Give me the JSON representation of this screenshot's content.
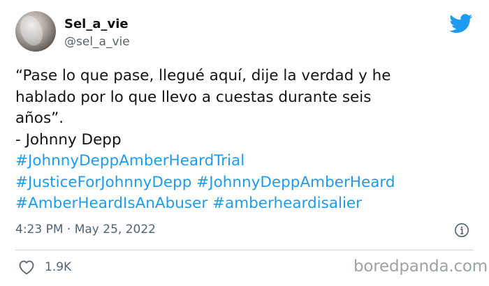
{
  "author": {
    "display_name": "Sel_a_vie",
    "handle": "@sel_a_vie"
  },
  "tweet": {
    "lines": [
      "“Pase lo que pase, llegué aquí, dije la verdad y he",
      "hablado por lo que llevo a cuestas durante seis",
      "años”.",
      "- Johnny Depp"
    ],
    "hashtags": [
      "#JohnnyDeppAmberHeardTrial",
      "#JusticeForJohnnyDepp",
      "#JohnnyDeppAmberHeard",
      "#AmberHeardIsAnAbuser",
      "#amberheardisalier"
    ],
    "timestamp": "4:23 PM · May 25, 2022",
    "likes": "1.9K"
  },
  "watermark": "boredpanda.com",
  "colors": {
    "accent": "#1d9bf0",
    "text": "#0f1419",
    "muted": "#536471"
  },
  "icons": [
    "twitter-bird-icon",
    "info-icon",
    "heart-icon"
  ]
}
